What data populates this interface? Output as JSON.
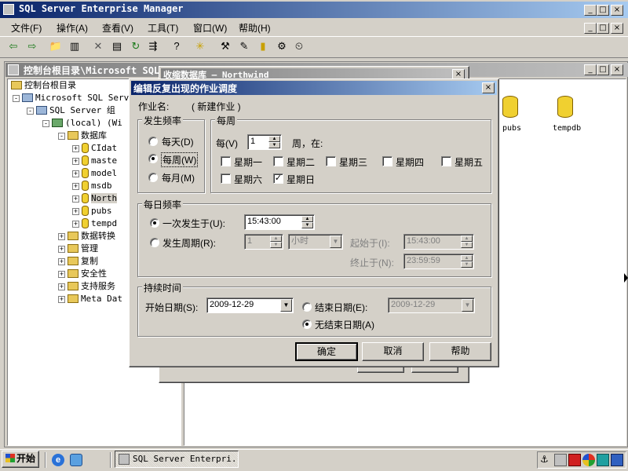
{
  "main_window": {
    "title": "SQL Server Enterprise Manager",
    "caption_buttons": [
      "_",
      "□",
      "×"
    ],
    "menu": [
      "文件(F)",
      "操作(A)",
      "查看(V)",
      "工具(T)",
      "窗口(W)",
      "帮助(H)"
    ]
  },
  "console_window": {
    "title": "控制台根目录\\Microsoft SQL",
    "tree": [
      {
        "label": "控制台根目录",
        "icon": "folder-icon"
      },
      {
        "label": "Microsoft SQL Serv",
        "icon": "server-group-icon",
        "expander": "-"
      },
      {
        "label": "SQL Server 组",
        "icon": "server-group-icon",
        "expander": "-"
      },
      {
        "label": "(local) (Wi",
        "icon": "server-icon",
        "expander": "-"
      },
      {
        "label": "数据库",
        "icon": "folder-icon",
        "expander": "-"
      },
      {
        "label": "CIdat",
        "icon": "database-icon",
        "expander": "+"
      },
      {
        "label": "maste",
        "icon": "database-icon",
        "expander": "+"
      },
      {
        "label": "model",
        "icon": "database-icon",
        "expander": "+"
      },
      {
        "label": "msdb",
        "icon": "database-icon",
        "expander": "+"
      },
      {
        "label": "North",
        "icon": "database-icon",
        "expander": "+"
      },
      {
        "label": "pubs",
        "icon": "database-icon",
        "expander": "+"
      },
      {
        "label": "tempd",
        "icon": "database-icon",
        "expander": "+"
      },
      {
        "label": "数据转换",
        "icon": "folder-icon",
        "expander": "+"
      },
      {
        "label": "管理",
        "icon": "folder-icon",
        "expander": "+"
      },
      {
        "label": "复制",
        "icon": "folder-icon",
        "expander": "+"
      },
      {
        "label": "安全性",
        "icon": "folder-icon",
        "expander": "+"
      },
      {
        "label": "支持服务",
        "icon": "folder-icon",
        "expander": "+"
      },
      {
        "label": "Meta Dat",
        "icon": "folder-icon",
        "expander": "+"
      }
    ],
    "list_items": [
      {
        "label": "pubs",
        "icon": "database-icon"
      },
      {
        "label": "tempdb",
        "icon": "database-icon"
      }
    ]
  },
  "shrink_window": {
    "title": "收缩数据库 — Northwind"
  },
  "dialog": {
    "title": "编辑反复出现的作业调度",
    "job_name_label": "作业名:",
    "job_name_value": "( 新建作业 )",
    "freq_group": "发生频率",
    "freq_options": [
      "每天(D)",
      "每周(W)",
      "每月(M)"
    ],
    "freq_selected": 1,
    "weekly_group": "每周",
    "every_label": "每(V)",
    "every_value": "1",
    "week_on_label": "周，在:",
    "weekdays": [
      {
        "label": "星期一",
        "checked": false
      },
      {
        "label": "星期二",
        "checked": false
      },
      {
        "label": "星期三",
        "checked": false
      },
      {
        "label": "星期四",
        "checked": false
      },
      {
        "label": "星期五",
        "checked": false
      },
      {
        "label": "星期六",
        "checked": false
      },
      {
        "label": "星期日",
        "checked": true
      }
    ],
    "daily_group": "每日频率",
    "once_label": "一次发生于(U):",
    "once_value": "15:43:00",
    "once_selected": true,
    "every_period_label": "发生周期(R):",
    "every_period_value": "1",
    "every_period_unit": "小时",
    "start_at_label": "起始于(I):",
    "start_at_value": "15:43:00",
    "end_at_label": "终止于(N):",
    "end_at_value": "23:59:59",
    "duration_group": "持续时间",
    "start_date_label": "开始日期(S):",
    "start_date_value": "2009-12-29",
    "end_date_label": "结束日期(E):",
    "end_date_value": "2009-12-29",
    "no_end_label": "无结束日期(A)",
    "no_end_selected": true,
    "ok": "确定",
    "cancel": "取消",
    "help": "帮助",
    "close": "×"
  },
  "taskbar": {
    "start": "开始",
    "task": "SQL Server Enterpri..."
  }
}
